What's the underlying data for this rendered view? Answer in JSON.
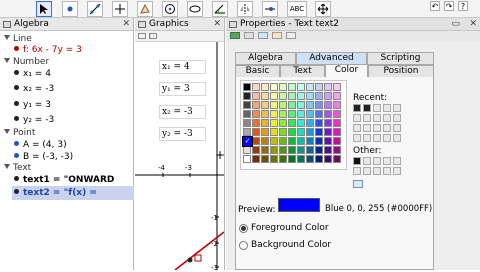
{
  "toolbar": {
    "tools": [
      "pointer",
      "point",
      "line",
      "perpendicular",
      "polygon",
      "circle",
      "conic",
      "angle",
      "reflect",
      "slider",
      "text",
      "move-view"
    ],
    "text_tool_label": "ABC"
  },
  "algebra": {
    "title": "Algebra",
    "categories": {
      "line": "Line",
      "number": "Number",
      "point": "Point",
      "text": "Text"
    },
    "items": {
      "f": "f: 6x - 7y = 3",
      "x1": "x₁ = 4",
      "x2": "x₂ = -3",
      "y1": "y₁ = 3",
      "y2": "y₂ = -3",
      "A": "A = (4, 3)",
      "B": "B = (-3, -3)",
      "text1": "text1 = \"ONWARD",
      "text2": "text2 = \"f(x) ="
    }
  },
  "graphics": {
    "title": "Graphics",
    "boxes": [
      "x₁ = 4",
      "y₁ = 3",
      "x₂ = -3",
      "y₂ = -3"
    ],
    "xticks": [
      "-4",
      "-3"
    ],
    "yticks": [
      "-1",
      "-2",
      "-3"
    ]
  },
  "properties": {
    "title": "Properties - Text text2",
    "tabs_row1": [
      "Algebra",
      "Advanced",
      "Scripting"
    ],
    "tabs_row2": [
      "Basic",
      "Text",
      "Color",
      "Position"
    ],
    "recent_label": "Recent:",
    "other_label": "Other:",
    "preview_label": "Preview:",
    "preview_color": "#0000FF",
    "preview_text": "Blue 0, 0, 255 (#0000FF)",
    "fg_label": "Foreground Color",
    "bg_label": "Background Color"
  }
}
